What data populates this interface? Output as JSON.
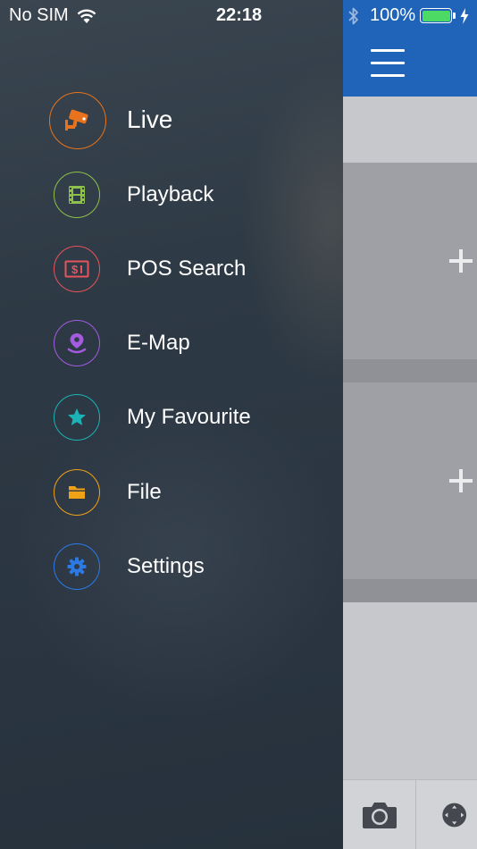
{
  "status_bar": {
    "carrier": "No SIM",
    "time": "22:18",
    "battery_percent": "100%",
    "battery_level": 1.0
  },
  "menu": {
    "items": [
      {
        "label": "Live",
        "icon": "surveillance-camera-icon",
        "color": "#e8731c"
      },
      {
        "label": "Playback",
        "icon": "film-strip-icon",
        "color": "#8fc04b"
      },
      {
        "label": "POS Search",
        "icon": "pos-receipt-icon",
        "color": "#e5545c"
      },
      {
        "label": "E-Map",
        "icon": "map-pin-icon",
        "color": "#a35be0"
      },
      {
        "label": "My Favourite",
        "icon": "star-icon",
        "color": "#1bb3b5"
      },
      {
        "label": "File",
        "icon": "folder-icon",
        "color": "#f0a217"
      },
      {
        "label": "Settings",
        "icon": "gear-icon",
        "color": "#2b7ae6"
      }
    ]
  },
  "colors": {
    "header_blue": "#1f64b9",
    "drawer_bg": "#2d3944",
    "video_slot": "#9ea0a6"
  }
}
